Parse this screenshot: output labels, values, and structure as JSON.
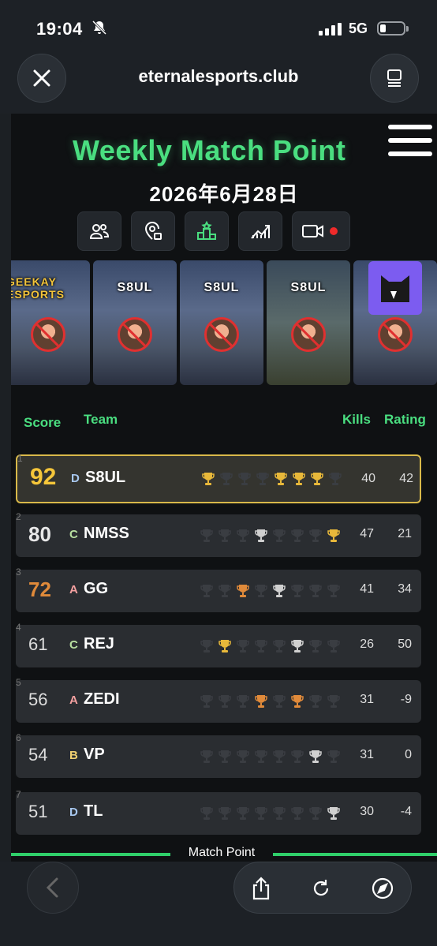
{
  "status_bar": {
    "time": "19:04",
    "network": "5G"
  },
  "browser": {
    "url": "eternalesports.club"
  },
  "header": {
    "title": "Weekly Match Point",
    "date": "2026年6月28日"
  },
  "toolbar_icons": [
    "users-icon",
    "location-icon",
    "podium-icon",
    "chart-icon",
    "video-live-icon"
  ],
  "cards": [
    {
      "logo": "GEEKAY ESPORTS"
    },
    {
      "logo": "S8UL"
    },
    {
      "logo": "S8UL"
    },
    {
      "logo": "S8UL"
    },
    {
      "logo": ""
    }
  ],
  "table": {
    "headers": {
      "score": "Score",
      "team": "Team",
      "kills": "Kills",
      "rating": "Rating"
    },
    "rows": [
      {
        "rank": "1",
        "score": "92",
        "grade": "D",
        "team": "S8UL",
        "kills": "40",
        "rating": "42",
        "trophies": [
          "gold",
          "none",
          "none",
          "none",
          "gold",
          "gold",
          "gold",
          "none"
        ]
      },
      {
        "rank": "2",
        "score": "80",
        "grade": "C",
        "team": "NMSS",
        "kills": "47",
        "rating": "21",
        "trophies": [
          "none",
          "none",
          "none",
          "silver",
          "none",
          "none",
          "none",
          "gold"
        ]
      },
      {
        "rank": "3",
        "score": "72",
        "grade": "A",
        "team": "GG",
        "kills": "41",
        "rating": "34",
        "trophies": [
          "none",
          "none",
          "bronze",
          "none",
          "silver",
          "none",
          "none",
          "none"
        ]
      },
      {
        "rank": "4",
        "score": "61",
        "grade": "C",
        "team": "REJ",
        "kills": "26",
        "rating": "50",
        "trophies": [
          "none",
          "gold",
          "none",
          "none",
          "none",
          "silver",
          "none",
          "none"
        ]
      },
      {
        "rank": "5",
        "score": "56",
        "grade": "A",
        "team": "ZEDI",
        "kills": "31",
        "rating": "-9",
        "trophies": [
          "none",
          "none",
          "none",
          "bronze",
          "none",
          "bronze",
          "none",
          "none"
        ]
      },
      {
        "rank": "6",
        "score": "54",
        "grade": "B",
        "team": "VP",
        "kills": "31",
        "rating": "0",
        "trophies": [
          "none",
          "none",
          "none",
          "none",
          "none",
          "none",
          "silver",
          "none"
        ]
      },
      {
        "rank": "7",
        "score": "51",
        "grade": "D",
        "team": "TL",
        "kills": "30",
        "rating": "-4",
        "trophies": [
          "none",
          "none",
          "none",
          "none",
          "none",
          "none",
          "none",
          "silver"
        ]
      }
    ]
  },
  "footer_label": "Match Point",
  "colors": {
    "accent": "#4ade80",
    "gold": "#e8b83a",
    "silver": "#d0d0d0",
    "bronze": "#e08a3a",
    "grade_a": "#f4a0a0",
    "grade_b": "#f0d070",
    "grade_c": "#b8e0a0",
    "grade_d": "#a8c8f0"
  }
}
